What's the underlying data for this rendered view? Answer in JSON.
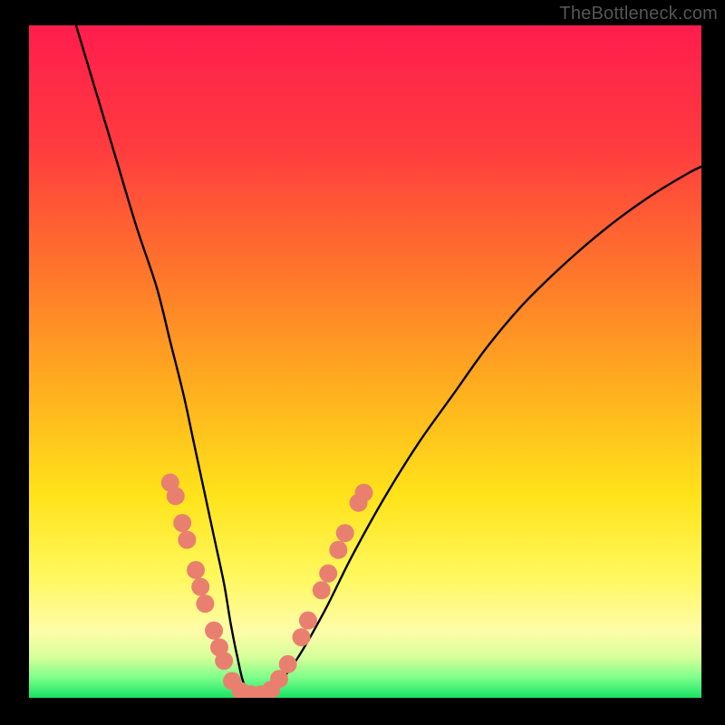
{
  "watermark": "TheBottleneck.com",
  "chart_data": {
    "type": "line",
    "title": "",
    "xlabel": "",
    "ylabel": "",
    "xlim": [
      0,
      100
    ],
    "ylim": [
      0,
      100
    ],
    "grid": false,
    "legend": false,
    "gradient_stops": [
      {
        "offset": 0,
        "color": "#ff1d4d"
      },
      {
        "offset": 18,
        "color": "#ff3b3f"
      },
      {
        "offset": 38,
        "color": "#ff7a2a"
      },
      {
        "offset": 55,
        "color": "#ffb21e"
      },
      {
        "offset": 70,
        "color": "#ffe31a"
      },
      {
        "offset": 82,
        "color": "#fff85e"
      },
      {
        "offset": 90,
        "color": "#fffca8"
      },
      {
        "offset": 94,
        "color": "#d6ff9a"
      },
      {
        "offset": 97,
        "color": "#7dff8a"
      },
      {
        "offset": 100,
        "color": "#17e264"
      }
    ],
    "series": [
      {
        "name": "bottleneck-curve",
        "x": [
          7,
          10,
          13,
          16,
          19,
          21,
          23,
          24.5,
          26,
          27.5,
          29,
          30,
          31,
          32,
          33.5,
          35,
          37,
          40,
          44,
          48,
          53,
          58,
          63,
          68,
          73,
          78,
          83,
          88,
          93,
          98,
          100
        ],
        "y": [
          100,
          90,
          80,
          70,
          61,
          53,
          45,
          38,
          31,
          24,
          17,
          11,
          6,
          2,
          0.5,
          0.5,
          2,
          6,
          13,
          21,
          30,
          38,
          45,
          52,
          58,
          63,
          67.5,
          71.5,
          75,
          78,
          79
        ]
      }
    ],
    "markers": {
      "name": "sample-points",
      "color": "#e9806f",
      "radius_px": 10,
      "points": [
        {
          "x": 21.0,
          "y": 32
        },
        {
          "x": 21.8,
          "y": 30
        },
        {
          "x": 22.8,
          "y": 26
        },
        {
          "x": 23.5,
          "y": 23.5
        },
        {
          "x": 24.8,
          "y": 19
        },
        {
          "x": 25.5,
          "y": 16.5
        },
        {
          "x": 26.2,
          "y": 14
        },
        {
          "x": 27.5,
          "y": 10
        },
        {
          "x": 28.3,
          "y": 7.5
        },
        {
          "x": 29.0,
          "y": 5.5
        },
        {
          "x": 30.2,
          "y": 2.5
        },
        {
          "x": 31.5,
          "y": 1.0
        },
        {
          "x": 33.0,
          "y": 0.5
        },
        {
          "x": 34.5,
          "y": 0.5
        },
        {
          "x": 36.0,
          "y": 1.2
        },
        {
          "x": 37.2,
          "y": 2.8
        },
        {
          "x": 38.5,
          "y": 5.0
        },
        {
          "x": 40.5,
          "y": 9.0
        },
        {
          "x": 41.5,
          "y": 11.5
        },
        {
          "x": 43.5,
          "y": 16.0
        },
        {
          "x": 44.5,
          "y": 18.5
        },
        {
          "x": 46.0,
          "y": 22.0
        },
        {
          "x": 47.0,
          "y": 24.5
        },
        {
          "x": 49.0,
          "y": 29.0
        },
        {
          "x": 49.8,
          "y": 30.5
        }
      ]
    }
  }
}
